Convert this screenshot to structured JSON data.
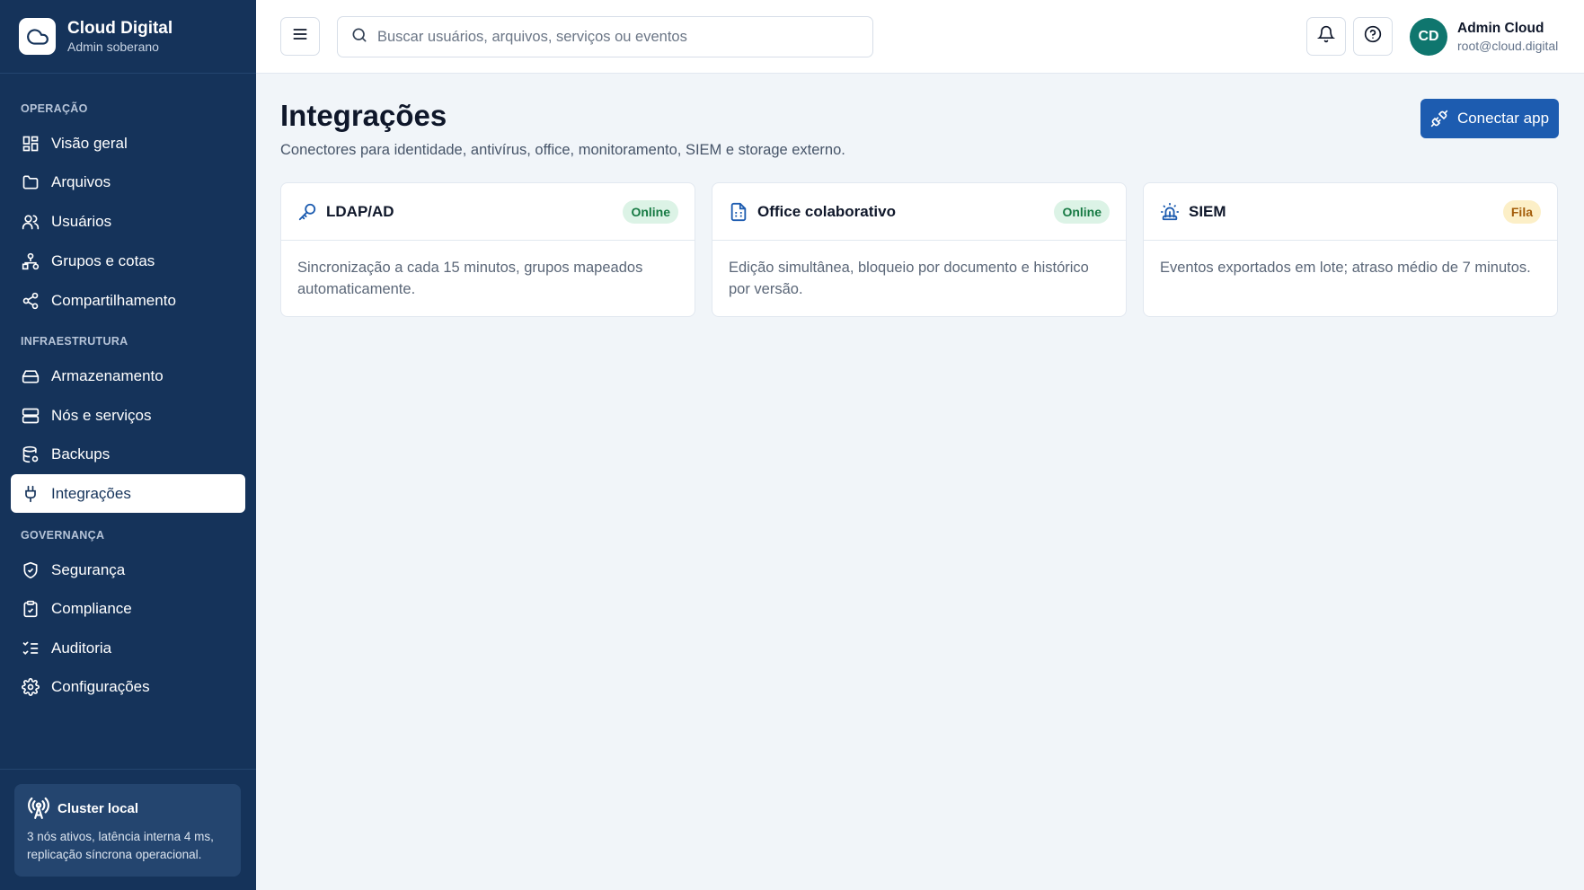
{
  "brand": {
    "title": "Cloud Digital",
    "subtitle": "Admin soberano",
    "logo_icon": "cloud-icon"
  },
  "sidebar": {
    "sections": [
      {
        "label": "OPERAÇÃO"
      },
      {
        "label": "INFRAESTRUTURA"
      },
      {
        "label": "GOVERNANÇA"
      }
    ],
    "items": [
      {
        "label": "Visão geral",
        "icon": "dashboard-grid-icon"
      },
      {
        "label": "Arquivos",
        "icon": "folder-icon"
      },
      {
        "label": "Usuários",
        "icon": "users-icon"
      },
      {
        "label": "Grupos e cotas",
        "icon": "hierarchy-icon"
      },
      {
        "label": "Compartilhamento",
        "icon": "share-icon"
      },
      {
        "label": "Armazenamento",
        "icon": "hard-drive-icon"
      },
      {
        "label": "Nós e serviços",
        "icon": "server-icon"
      },
      {
        "label": "Backups",
        "icon": "database-backup-icon"
      },
      {
        "label": "Integrações",
        "icon": "plug-icon",
        "active": true
      },
      {
        "label": "Segurança",
        "icon": "shield-check-icon"
      },
      {
        "label": "Compliance",
        "icon": "clipboard-check-icon"
      },
      {
        "label": "Auditoria",
        "icon": "list-checks-icon"
      },
      {
        "label": "Configurações",
        "icon": "gear-icon"
      }
    ],
    "cluster": {
      "title": "Cluster local",
      "text": "3 nós ativos, latência interna 4 ms, replicação síncrona operacional.",
      "icon": "radio-tower-icon"
    }
  },
  "topbar": {
    "search_placeholder": "Buscar usuários, arquivos, serviços ou eventos",
    "user": {
      "initials": "CD",
      "name": "Admin Cloud",
      "email": "root@cloud.digital"
    }
  },
  "page": {
    "title": "Integrações",
    "subtitle": "Conectores para identidade, antivírus, office, monitoramento, SIEM e storage externo.",
    "primary_action": "Conectar app"
  },
  "cards": [
    {
      "title": "LDAP/AD",
      "status": "Online",
      "icon": "key-icon",
      "body": "Sincronização a cada 15 minutos, grupos mapeados automaticamente."
    },
    {
      "title": "Office colaborativo",
      "status": "Online",
      "icon": "document-icon",
      "body": "Edição simultânea, bloqueio por documento e histórico por versão."
    },
    {
      "title": "SIEM",
      "status": "Fila",
      "icon": "siren-icon",
      "body": "Eventos exportados em lote; atraso médio de 7 minutos."
    }
  ],
  "colors": {
    "sidebar_bg": "#15335a",
    "primary": "#1d5cb0",
    "online_badge": "#dcf3e6",
    "queue_badge": "#fcefc7",
    "avatar": "#0f766e"
  }
}
